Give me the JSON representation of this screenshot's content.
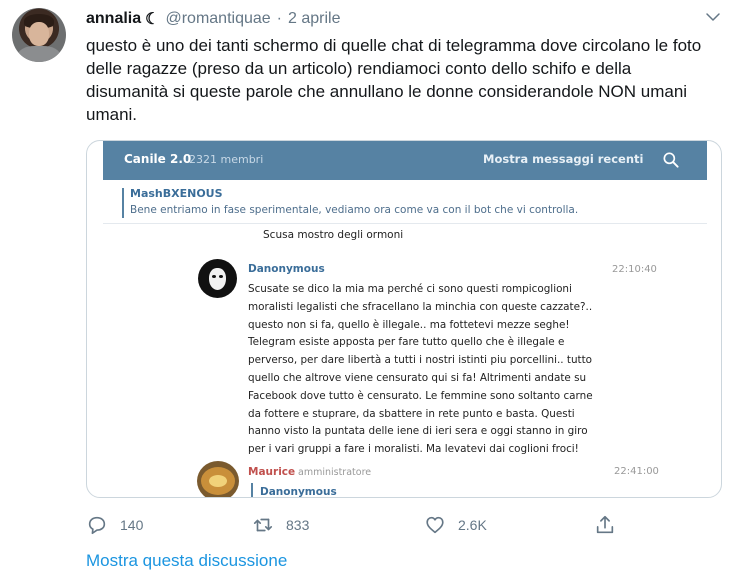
{
  "tweet": {
    "author_name": "annalia",
    "author_symbol": "☾",
    "handle": "@romantiquae",
    "separator": "·",
    "date": "2 aprile",
    "text": "questo è uno dei tanti schermo di quelle chat di telegramma dove circolano le foto delle ragazze (preso da un articolo) rendiamoci conto dello schifo e della disumanità si queste parole che annullano le donne considerandole NON umani umani."
  },
  "telegram": {
    "chat_title": "Canile 2.0",
    "members": "2321 membri",
    "recent_messages": "Mostra messaggi recenti",
    "pinned_name": "MashBXENOUS",
    "pinned_text": "Bene entriamo in fase sperimentale, vediamo ora come va con il bot che vi controlla.",
    "prev_line": "Scusa mostro degli ormoni",
    "msg1_author": "Danonymous",
    "msg1_time": "22:10:40",
    "msg1_text": "Scusate se dico la mia ma perché ci sono questi rompicoglioni moralisti legalisti che sfracellano la minchia con queste cazzate?.. questo non si fa, quello è illegale.. ma fottetevi mezze seghe! Telegram esiste apposta per fare tutto quello che è illegale e perverso, per dare libertà a tutti i nostri istinti piu porcellini.. tutto quello che altrove viene censurato qui si fa! Altrimenti andate su Facebook dove tutto è censurato. Le femmine sono soltanto carne da fottere e stuprare, da sbattere in rete punto e basta. Questi hanno visto la puntata delle iene di ieri sera e oggi stanno in giro per i vari gruppi a fare i moralisti. Ma levatevi dai coglioni froci!",
    "msg2_author": "Maurice",
    "msg2_role": "amministratore",
    "msg2_time": "22:41:00",
    "msg2_reply_to": "Danonymous"
  },
  "actions": {
    "replies": "140",
    "retweets": "833",
    "likes": "2.6K"
  },
  "thread_link": "Mostra questa discussione",
  "icons": {
    "chevron": "chevron-down-icon",
    "reply": "reply-icon",
    "retweet": "retweet-icon",
    "like": "heart-icon",
    "share": "share-icon",
    "search": "search-icon"
  },
  "colors": {
    "accent": "#1b95e0",
    "muted": "#657786",
    "telegram_bar": "#5682a3",
    "admin_name": "#c0504d"
  }
}
